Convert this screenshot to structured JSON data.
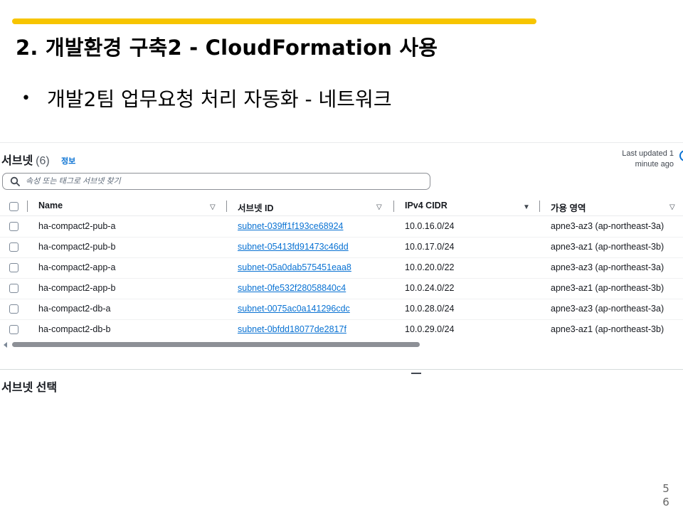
{
  "slide": {
    "title": "2. 개발환경 구축2 - CloudFormation 사용",
    "bullet": "개발2팀 업무요청 처리 자동화 - 네트워크",
    "page_number": "56",
    "accent_color": "#f7c500"
  },
  "panel": {
    "title": "서브넷",
    "count": "(6)",
    "info_link": "정보",
    "last_updated": "Last updated 1 minute ago",
    "search_placeholder": "속성 또는 태그로 서브넷 찾기",
    "link_color": "#0972d3"
  },
  "table": {
    "columns": [
      "Name",
      "서브넷 ID",
      "IPv4 CIDR",
      "가용 영역"
    ],
    "rows": [
      {
        "name": "ha-compact2-pub-a",
        "subnet_id": "subnet-039ff1f193ce68924",
        "cidr": "10.0.16.0/24",
        "az": "apne3-az3 (ap-northeast-3a)"
      },
      {
        "name": "ha-compact2-pub-b",
        "subnet_id": "subnet-05413fd91473c46dd",
        "cidr": "10.0.17.0/24",
        "az": "apne3-az1 (ap-northeast-3b)"
      },
      {
        "name": "ha-compact2-app-a",
        "subnet_id": "subnet-05a0dab575451eaa8",
        "cidr": "10.0.20.0/22",
        "az": "apne3-az3 (ap-northeast-3a)"
      },
      {
        "name": "ha-compact2-app-b",
        "subnet_id": "subnet-0fe532f28058840c4",
        "cidr": "10.0.24.0/22",
        "az": "apne3-az1 (ap-northeast-3b)"
      },
      {
        "name": "ha-compact2-db-a",
        "subnet_id": "subnet-0075ac0a141296cdc",
        "cidr": "10.0.28.0/24",
        "az": "apne3-az3 (ap-northeast-3a)"
      },
      {
        "name": "ha-compact2-db-b",
        "subnet_id": "subnet-0bfdd18077de2817f",
        "cidr": "10.0.29.0/24",
        "az": "apne3-az1 (ap-northeast-3b)"
      }
    ]
  },
  "selection": {
    "title": "서브넷 선택"
  }
}
